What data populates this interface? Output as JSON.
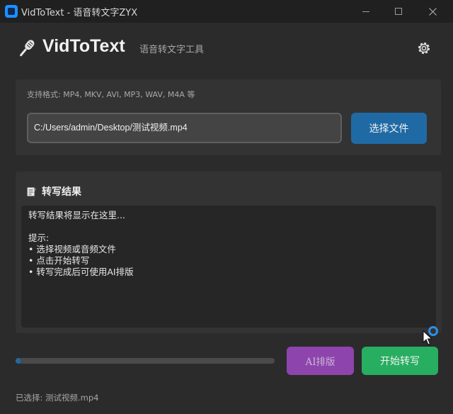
{
  "window": {
    "title": "VidToText - 语音转文字ZYX",
    "icon": "app-icon",
    "minimize_icon": "minimize-icon",
    "maximize_icon": "maximize-icon",
    "close_icon": "close-icon"
  },
  "header": {
    "icon": "microphone-icon",
    "app_name": "VidToText",
    "subtitle": "语音转文字工具",
    "settings_icon": "gear-icon"
  },
  "file_panel": {
    "formats_text": "支持格式: MP4, MKV, AVI, MP3, WAV, M4A 等",
    "path_value": "C:/Users/admin/Desktop/测试视频.mp4",
    "choose_button": "选择文件"
  },
  "result_panel": {
    "icon": "memo-icon",
    "title": "转写结果",
    "text": "转写结果将显示在这里...\n\n提示:\n• 选择视频或音频文件\n• 点击开始转写\n• 转写完成后可使用AI排版"
  },
  "progress": {
    "value": 0.02
  },
  "buttons": {
    "ai_format": "AI排版",
    "start_transcribe": "开始转写"
  },
  "status": {
    "selected": "已选择: 测试视频.mp4"
  },
  "colors": {
    "accent_blue": "#1f6aa5",
    "ai_purple": "#8e44ad",
    "start_green": "#27ae60",
    "background": "#2b2b2b",
    "panel": "#333333"
  }
}
